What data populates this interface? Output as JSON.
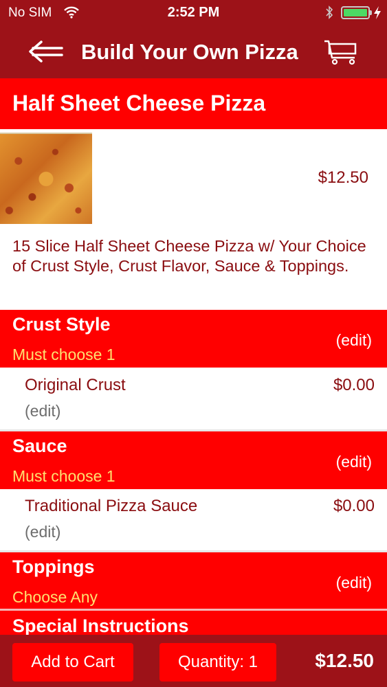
{
  "status_bar": {
    "carrier": "No SIM",
    "time": "2:52 PM",
    "wifi_icon": "wifi-icon",
    "bluetooth_icon": "bluetooth-icon",
    "battery_level": 1.0,
    "battery_color": "#4cd964"
  },
  "nav": {
    "title": "Build Your Own Pizza",
    "back_icon": "arrow-left-icon",
    "cart_icon": "cart-icon"
  },
  "product": {
    "title": "Half Sheet Cheese Pizza",
    "price": "$12.50",
    "description": "15 Slice Half Sheet Cheese Pizza w/ Your Choice of Crust Style, Crust Flavor, Sauce & Toppings."
  },
  "sections": [
    {
      "title": "Crust Style",
      "subtitle": "Must choose 1",
      "edit_label": "(edit)",
      "option": {
        "name": "Original Crust",
        "price": "$0.00",
        "edit_label": "(edit)"
      }
    },
    {
      "title": "Sauce",
      "subtitle": "Must choose 1",
      "edit_label": "(edit)",
      "option": {
        "name": "Traditional Pizza Sauce",
        "price": "$0.00",
        "edit_label": "(edit)"
      }
    },
    {
      "title": "Toppings",
      "subtitle": "Choose Any",
      "edit_label": "(edit)"
    },
    {
      "title": "Special Instructions"
    }
  ],
  "bottom_bar": {
    "add_to_cart_label": "Add to Cart",
    "quantity_label": "Quantity: 1",
    "total": "$12.50"
  },
  "colors": {
    "bar_dark_red": "#9d1218",
    "accent_red": "#ff0000",
    "text_dark_red": "#8a0d10",
    "subtitle_yellow": "#ffe070"
  }
}
